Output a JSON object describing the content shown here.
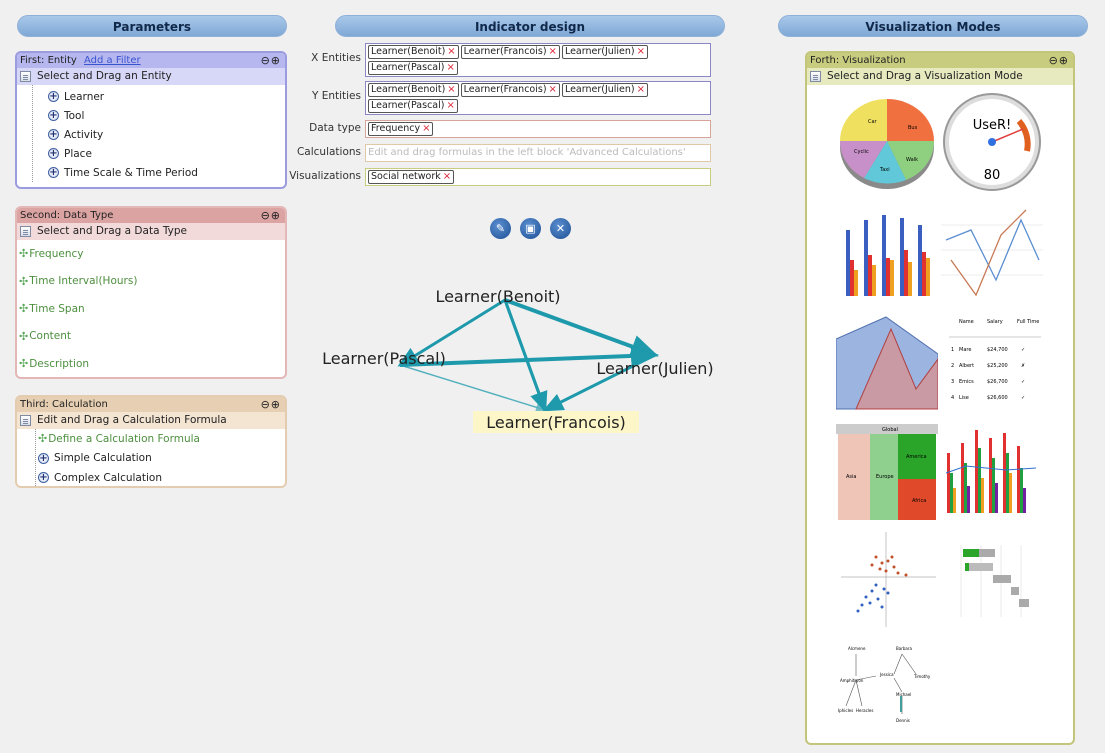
{
  "headers": {
    "parameters": "Parameters",
    "indicator": "Indicator design",
    "visualization": "Visualization Modes"
  },
  "entity_panel": {
    "title": "First: Entity",
    "link": "Add a Filter",
    "subtitle": "Select and Drag an Entity",
    "items": [
      "Learner",
      "Tool",
      "Activity",
      "Place",
      "Time Scale & Time Period"
    ]
  },
  "dtype_panel": {
    "title": "Second: Data Type",
    "subtitle": "Select and Drag a Data Type",
    "items": [
      "Frequency",
      "Time Interval(Hours)",
      "Time Span",
      "Content",
      "Description"
    ]
  },
  "calc_panel": {
    "title": "Third: Calculation",
    "subtitle": "Edit and Drag a Calculation Formula",
    "define": "Define a Calculation Formula",
    "simple": "Simple Calculation",
    "complex": "Complex Calculation"
  },
  "indicator": {
    "x_label": "X Entities",
    "x_tags": [
      "Learner(Benoit)",
      "Learner(Francois)",
      "Learner(Julien)",
      "Learner(Pascal)"
    ],
    "y_label": "Y Entities",
    "y_tags": [
      "Learner(Benoit)",
      "Learner(Francois)",
      "Learner(Julien)",
      "Learner(Pascal)"
    ],
    "dtype_label": "Data type",
    "dtype_tag": "Frequency",
    "calc_label": "Calculations",
    "calc_placeholder": "Edit and drag formulas in the left block 'Advanced Calculations'",
    "vis_label": "Visualizations",
    "vis_tag": "Social network",
    "remove_glyph": "×"
  },
  "graph": {
    "nodes": [
      "Learner(Benoit)",
      "Learner(Pascal)",
      "Learner(Julien)",
      "Learner(Francois)"
    ]
  },
  "vis_panel": {
    "title": "Forth: Visualization",
    "subtitle": "Select and Drag a Visualization Mode",
    "pie_labels": [
      "Car",
      "Bus",
      "Walk",
      "Taxi",
      "Cyclic"
    ],
    "gauge_title": "UseR!",
    "gauge_value": "80",
    "table_headers": [
      "Name",
      "Salary",
      "Full Time"
    ],
    "table_rows": [
      [
        "1",
        "Mare",
        "$24,700",
        "✓"
      ],
      [
        "2",
        "Albert",
        "$25,200",
        "✗"
      ],
      [
        "3",
        "Emics",
        "$26,700",
        "✓"
      ],
      [
        "4",
        "Lise",
        "$26,600",
        "✓"
      ]
    ],
    "treemap_labels": [
      "Global",
      "Asia",
      "Europe",
      "America",
      "Africa"
    ],
    "tree_names": [
      "Alcmene",
      "Barbara",
      "Amphitryon",
      "Jessica",
      "Timothy",
      "Iphicles",
      "Heracles",
      "Michael",
      "Dennis"
    ]
  },
  "colors": {
    "header": "#8fb0d8",
    "entity": "#b7b7f0",
    "dtype": "#dca3a3",
    "calc": "#e6cfb2",
    "vis": "#c8cc7f",
    "graph_edge": "#1e9aac"
  }
}
